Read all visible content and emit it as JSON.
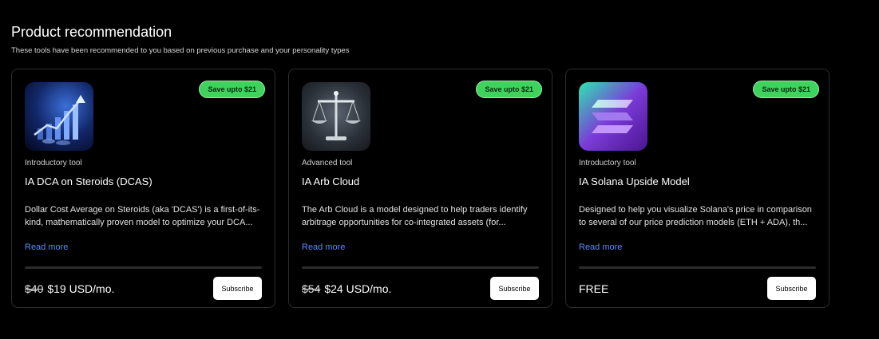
{
  "header": {
    "title": "Product recommendation",
    "subtitle": "These tools have been recommended to you based on previous purchase and your personality types"
  },
  "cards": [
    {
      "badge": "Save upto $21",
      "tier": "Introductory tool",
      "name": "IA DCA on Steroids (DCAS)",
      "description": "Dollar Cost Average on Steroids (aka 'DCAS') is a first-of-its-kind, mathematically proven model to optimize your DCA...",
      "read_more": "Read more",
      "old_price": "$40",
      "price": "$19 USD/mo.",
      "subscribe": "Subscribe",
      "icon": "chart-growth-icon"
    },
    {
      "badge": "Save upto $21",
      "tier": "Advanced tool",
      "name": "IA Arb Cloud",
      "description": "The Arb Cloud is a model designed to help traders identify arbitrage opportunities for co-integrated assets (for...",
      "read_more": "Read more",
      "old_price": "$54",
      "price": "$24 USD/mo.",
      "subscribe": "Subscribe",
      "icon": "balance-scale-icon"
    },
    {
      "badge": "Save upto $21",
      "tier": "Introductory tool",
      "name": "IA Solana Upside Model",
      "description": "Designed to help you visualize Solana's price in comparison to several of our price prediction models (ETH + ADA), th...",
      "read_more": "Read more",
      "old_price": "",
      "price": "FREE",
      "subscribe": "Subscribe",
      "icon": "solana-logo-icon"
    }
  ],
  "colors": {
    "background": "#000000",
    "card_border": "#2c2c2c",
    "badge_green": "#3fd35e",
    "link_blue": "#5b8bff"
  }
}
